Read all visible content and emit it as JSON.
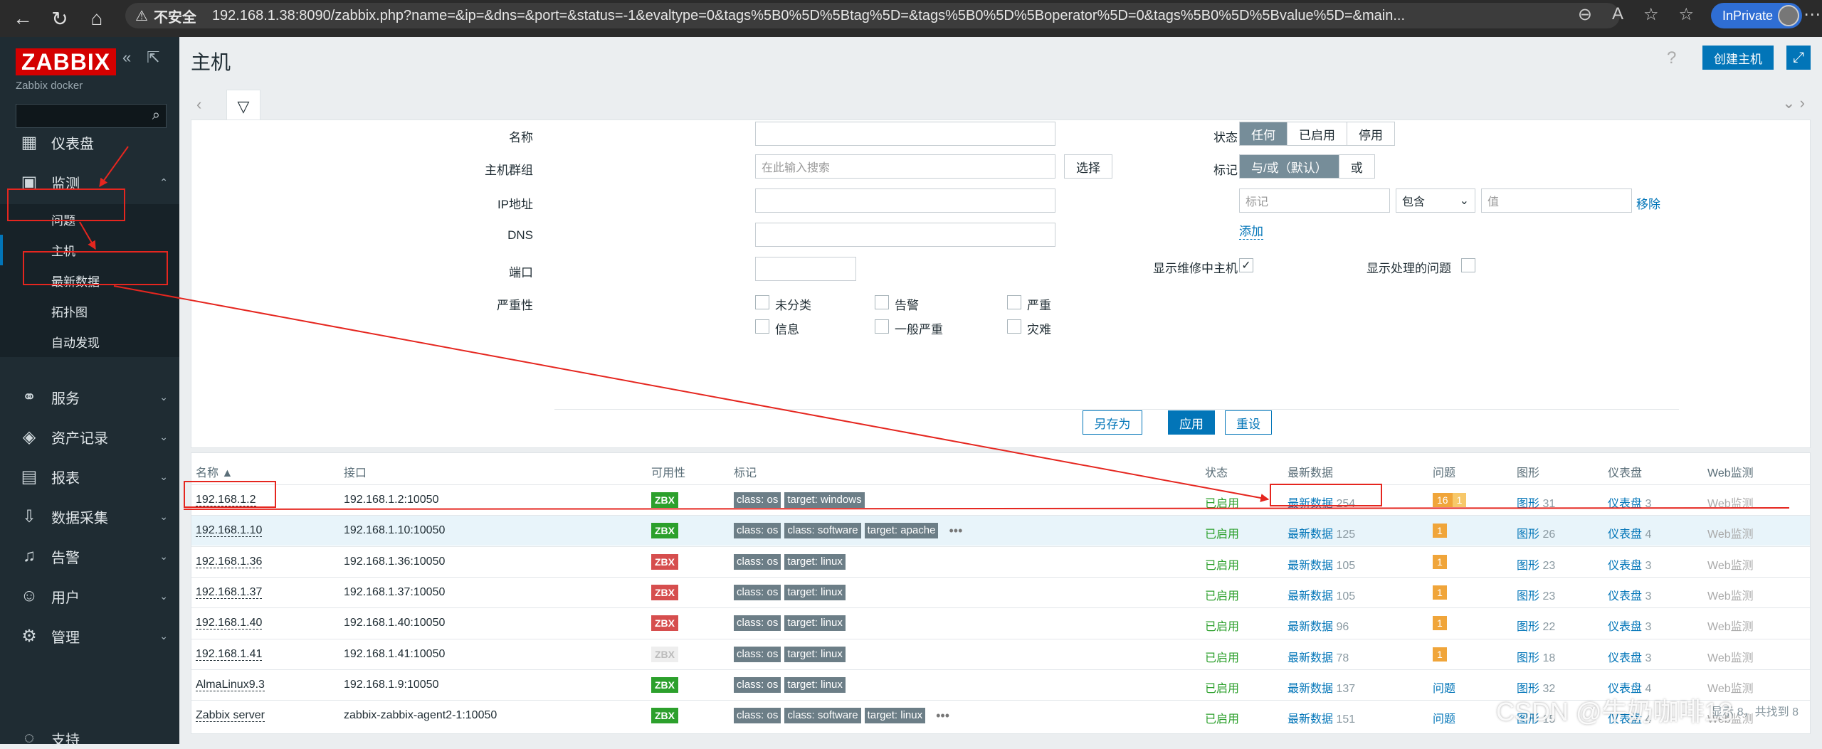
{
  "browser": {
    "security_label": "不安全",
    "url": "192.168.1.38:8090/zabbix.php?name=&ip=&dns=&port=&status=-1&evaltype=0&tags%5B0%5D%5Btag%5D=&tags%5B0%5D%5Boperator%5D=0&tags%5B0%5D%5Bvalue%5D=&main...",
    "inprivate_label": "InPrivate"
  },
  "sidebar": {
    "logo": "ZABBIX",
    "server_name": "Zabbix docker",
    "menu": [
      {
        "label": "仪表盘",
        "icon": "dashboard-icon"
      },
      {
        "label": "监测",
        "icon": "monitoring-icon"
      },
      {
        "label": "服务",
        "icon": "services-icon"
      },
      {
        "label": "资产记录",
        "icon": "inventory-icon"
      },
      {
        "label": "报表",
        "icon": "reports-icon"
      },
      {
        "label": "数据采集",
        "icon": "data-collection-icon"
      },
      {
        "label": "告警",
        "icon": "alerts-icon"
      },
      {
        "label": "用户",
        "icon": "users-icon"
      },
      {
        "label": "管理",
        "icon": "administration-icon"
      }
    ],
    "submenu": [
      "问题",
      "主机",
      "最新数据",
      "拓扑图",
      "自动发现"
    ],
    "bottom_item": "支持"
  },
  "header": {
    "title": "主机",
    "help": "?",
    "create_button": "创建主机"
  },
  "filter": {
    "labels": {
      "name": "名称",
      "host_group": "主机群组",
      "ip": "IP地址",
      "dns": "DNS",
      "port": "端口",
      "severity": "严重性",
      "status": "状态",
      "tags": "标记",
      "show_maintenance": "显示维修中主机",
      "show_suppressed": "显示处理的问题"
    },
    "host_group_placeholder": "在此输入搜索",
    "select_button": "选择",
    "status_options": [
      "任何",
      "已启用",
      "停用"
    ],
    "tag_eval_options": [
      "与/或（默认）",
      "或"
    ],
    "tag_placeholder": "标记",
    "tag_operator": "包含",
    "value_placeholder": "值",
    "remove_link": "移除",
    "add_link": "添加",
    "severities": [
      "未分类",
      "告警",
      "严重",
      "信息",
      "一般严重",
      "灾难"
    ],
    "save_as": "另存为",
    "apply": "应用",
    "reset": "重设"
  },
  "table": {
    "headers": [
      "名称 ▲",
      "接口",
      "可用性",
      "标记",
      "状态",
      "最新数据",
      "问题",
      "图形",
      "仪表盘",
      "Web监测"
    ],
    "rows": [
      {
        "name": "192.168.1.2",
        "interface": "192.168.1.2:10050",
        "avail": "ZBX",
        "avail_color": "green",
        "tags": [
          "class: os",
          "target: windows"
        ],
        "more": "",
        "status": "已启用",
        "latest": "最新数据",
        "latest_count": "254",
        "problems": [
          "16",
          "1"
        ],
        "graphs": "图形",
        "graphs_count": "31",
        "dash": "仪表盘",
        "dash_count": "3",
        "web": "Web监测"
      },
      {
        "name": "192.168.1.10",
        "interface": "192.168.1.10:10050",
        "avail": "ZBX",
        "avail_color": "green",
        "tags": [
          "class: os",
          "class: software",
          "target: apache"
        ],
        "more": "•••",
        "status": "已启用",
        "latest": "最新数据",
        "latest_count": "125",
        "problems": [
          "1"
        ],
        "graphs": "图形",
        "graphs_count": "26",
        "dash": "仪表盘",
        "dash_count": "4",
        "web": "Web监测"
      },
      {
        "name": "192.168.1.36",
        "interface": "192.168.1.36:10050",
        "avail": "ZBX",
        "avail_color": "red",
        "tags": [
          "class: os",
          "target: linux"
        ],
        "more": "",
        "status": "已启用",
        "latest": "最新数据",
        "latest_count": "105",
        "problems": [
          "1"
        ],
        "graphs": "图形",
        "graphs_count": "23",
        "dash": "仪表盘",
        "dash_count": "3",
        "web": "Web监测"
      },
      {
        "name": "192.168.1.37",
        "interface": "192.168.1.37:10050",
        "avail": "ZBX",
        "avail_color": "red",
        "tags": [
          "class: os",
          "target: linux"
        ],
        "more": "",
        "status": "已启用",
        "latest": "最新数据",
        "latest_count": "105",
        "problems": [
          "1"
        ],
        "graphs": "图形",
        "graphs_count": "23",
        "dash": "仪表盘",
        "dash_count": "3",
        "web": "Web监测"
      },
      {
        "name": "192.168.1.40",
        "interface": "192.168.1.40:10050",
        "avail": "ZBX",
        "avail_color": "red",
        "tags": [
          "class: os",
          "target: linux"
        ],
        "more": "",
        "status": "已启用",
        "latest": "最新数据",
        "latest_count": "96",
        "problems": [
          "1"
        ],
        "graphs": "图形",
        "graphs_count": "22",
        "dash": "仪表盘",
        "dash_count": "3",
        "web": "Web监测"
      },
      {
        "name": "192.168.1.41",
        "interface": "192.168.1.41:10050",
        "avail": "ZBX",
        "avail_color": "grey",
        "tags": [
          "class: os",
          "target: linux"
        ],
        "more": "",
        "status": "已启用",
        "latest": "最新数据",
        "latest_count": "78",
        "problems": [
          "1"
        ],
        "graphs": "图形",
        "graphs_count": "18",
        "dash": "仪表盘",
        "dash_count": "3",
        "web": "Web监测"
      },
      {
        "name": "AlmaLinux9.3",
        "interface": "192.168.1.9:10050",
        "avail": "ZBX",
        "avail_color": "green",
        "tags": [
          "class: os",
          "target: linux"
        ],
        "more": "",
        "status": "已启用",
        "latest": "最新数据",
        "latest_count": "137",
        "problems_link": "问题",
        "graphs": "图形",
        "graphs_count": "32",
        "dash": "仪表盘",
        "dash_count": "4",
        "web": "Web监测"
      },
      {
        "name": "Zabbix server",
        "interface": "zabbix-zabbix-agent2-1:10050",
        "avail": "ZBX",
        "avail_color": "green",
        "tags": [
          "class: os",
          "class: software",
          "target: linux"
        ],
        "more": "•••",
        "status": "已启用",
        "latest": "最新数据",
        "latest_count": "151",
        "problems_link": "问题",
        "graphs": "图形",
        "graphs_count": "15",
        "dash": "仪表盘",
        "dash_count": "4",
        "web": "Web监测"
      }
    ],
    "footer": "显示 8，共找到 8"
  },
  "watermark": "CSDN @牛奶咖啡13",
  "colors": {
    "accent": "#0275b8",
    "sidebar": "#1f2c33",
    "ok": "#2ca02c",
    "error": "#d64e4e",
    "annotation": "#e5261f"
  }
}
